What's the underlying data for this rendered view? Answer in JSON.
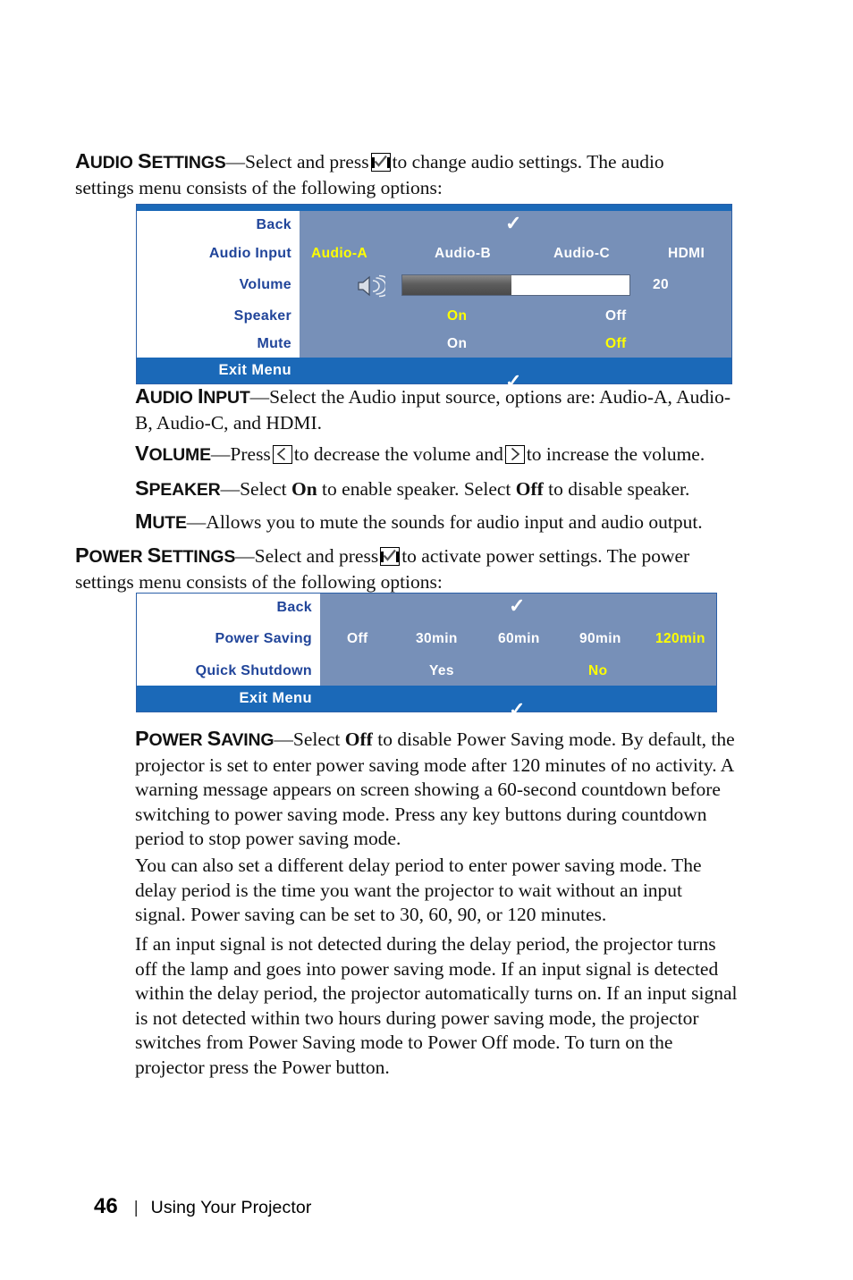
{
  "page": {
    "number": "46",
    "footer_separator": "|",
    "footer_title": "Using Your Projector"
  },
  "sections": {
    "audio_settings": {
      "term_small": "UDIO ",
      "term_cap1": "A",
      "term_cap2": "S",
      "term_small2": "ETTINGS",
      "label": "AUDIO SETTINGS",
      "text_before_icon": "—Select and press",
      "icon": "enter-key-icon",
      "text_after_icon": "to change audio settings. The audio settings menu consists of the following options:"
    },
    "audio_input": {
      "cap": "A",
      "rest": "UDIO ",
      "cap2": "I",
      "rest2": "NPUT",
      "label": "AUDIO INPUT",
      "text": "—Select the Audio input source, options are: Audio-A, Audio-B, Audio-C, and HDMI."
    },
    "volume": {
      "cap": "V",
      "rest": "OLUME",
      "label": "VOLUME",
      "text_1": "—Press",
      "icon_left": "left-arrow-key-icon",
      "text_2": "to decrease the volume and",
      "icon_right": "right-arrow-key-icon",
      "text_3": "to increase the volume."
    },
    "speaker": {
      "cap": "S",
      "rest": "PEAKER",
      "label": "SPEAKER",
      "text_1": "—Select ",
      "bold_1": "On",
      "text_2": " to enable speaker. Select ",
      "bold_2": "Off",
      "text_3": " to disable speaker."
    },
    "mute": {
      "cap": "M",
      "rest": "UTE",
      "label": "MUTE",
      "text": "—Allows you to mute the sounds for audio input and audio output."
    },
    "power_settings": {
      "cap": "P",
      "rest": "OWER ",
      "cap2": "S",
      "rest2": "ETTINGS",
      "label": "POWER SETTINGS",
      "text_before_icon": "—Select and press",
      "icon": "enter-key-icon",
      "text_after_icon": "to activate power settings. The power settings menu consists of the following options:"
    },
    "power_saving": {
      "cap": "P",
      "rest": "OWER ",
      "cap2": "S",
      "rest2": "AVING",
      "label": "POWER SAVING",
      "text_1": "—Select ",
      "bold_1": "Off",
      "text_2": " to disable Power Saving mode. By default, the projector is set to enter power saving mode after 120 minutes of no activity. A warning message appears on screen showing a 60-second countdown before switching to power saving mode. Press any key buttons during countdown period to stop power saving mode."
    },
    "paragraph_2": "You can also set a different delay period to enter power saving mode. The delay period is the time you want the projector to wait without an input signal. Power saving can be set to 30, 60, 90, or 120 minutes.",
    "paragraph_3": "If an input signal is not detected during the delay period, the projector turns off the lamp and goes into power saving mode. If an input signal is detected within the delay period, the projector automatically turns on. If an input signal is not detected within two hours during power saving mode, the projector switches from Power Saving mode to Power Off mode. To turn on the projector press the Power button."
  },
  "audio_menu": {
    "rows": [
      {
        "label": "Back",
        "type": "check"
      },
      {
        "label": "Audio Input",
        "type": "options",
        "options": [
          {
            "text": "Audio-A",
            "selected": true
          },
          {
            "text": "Audio-B",
            "selected": false
          },
          {
            "text": "Audio-C",
            "selected": false
          },
          {
            "text": "HDMI",
            "selected": false
          }
        ]
      },
      {
        "label": "Volume",
        "type": "slider",
        "value": "20",
        "percent": 48,
        "icon": "speaker-icon"
      },
      {
        "label": "Speaker",
        "type": "options",
        "options": [
          {
            "text": "On",
            "selected": true
          },
          {
            "text": "Off",
            "selected": false
          }
        ]
      },
      {
        "label": "Mute",
        "type": "options",
        "options": [
          {
            "text": "On",
            "selected": false
          },
          {
            "text": "Off",
            "selected": true
          }
        ]
      }
    ],
    "exit_label": "Exit Menu",
    "check_glyph": "✓"
  },
  "power_menu": {
    "rows": [
      {
        "label": "Back",
        "type": "check"
      },
      {
        "label": "Power Saving",
        "type": "options",
        "options": [
          {
            "text": "Off",
            "selected": false
          },
          {
            "text": "30min",
            "selected": false
          },
          {
            "text": "60min",
            "selected": false
          },
          {
            "text": "90min",
            "selected": false
          },
          {
            "text": "120min",
            "selected": true
          }
        ]
      },
      {
        "label": "Quick Shutdown",
        "type": "options",
        "options": [
          {
            "text": "Yes",
            "selected": false
          },
          {
            "text": "No",
            "selected": true
          }
        ]
      }
    ],
    "exit_label": "Exit Menu",
    "check_glyph": "✓"
  },
  "colors": {
    "menu_header_blue": "#1b69b8",
    "menu_value_bg": "#7790b8",
    "menu_label_text": "#21459a",
    "selected_yellow": "#ffff00",
    "value_white": "#ffffff"
  }
}
